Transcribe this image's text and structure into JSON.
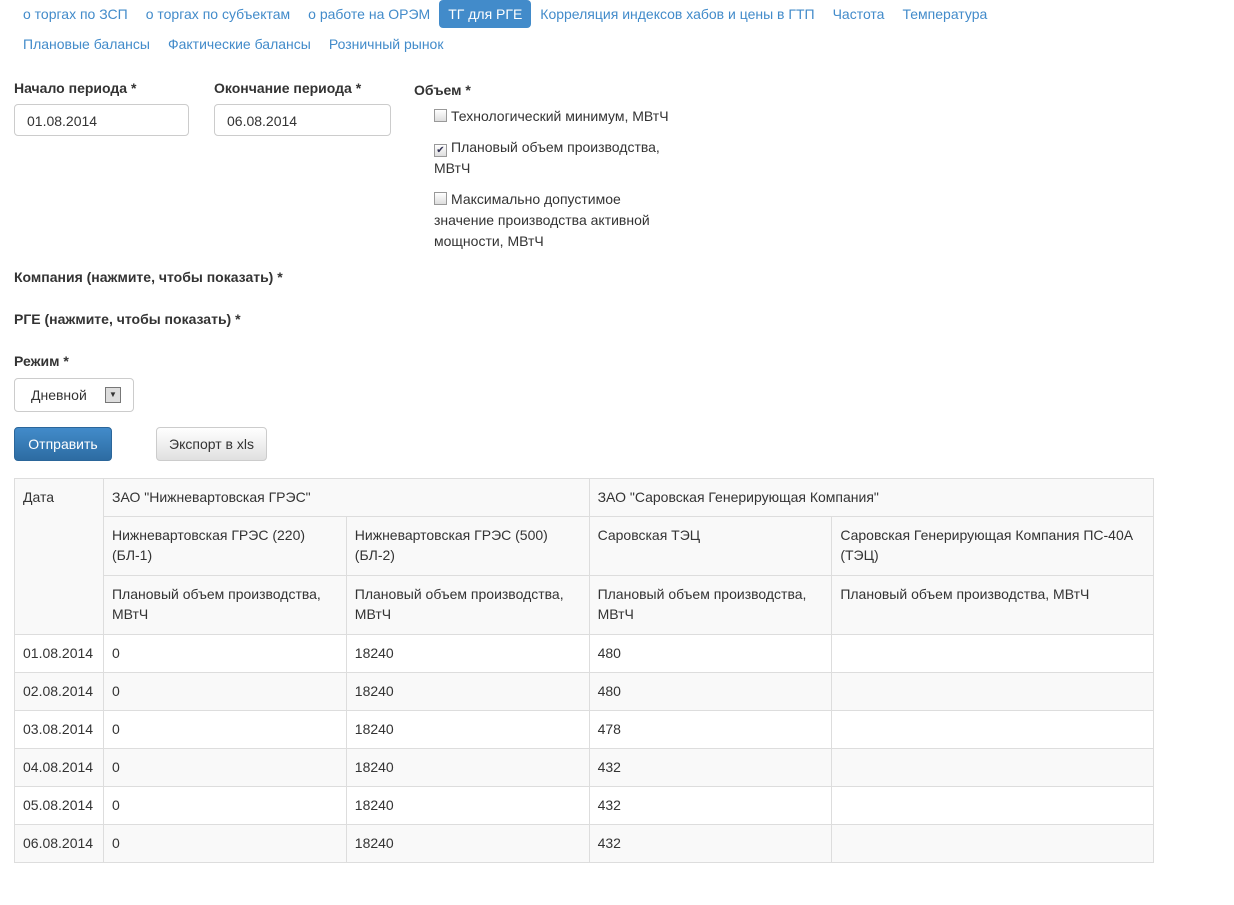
{
  "nav": {
    "row1": [
      "о торгах по ЗСП",
      "о торгах по субъектам",
      "о работе на ОРЭМ",
      "ТГ для РГЕ",
      "Корреляция индексов хабов и цены в ГТП",
      "Частота",
      "Температура"
    ],
    "row2": [
      "Плановые балансы",
      "Фактические балансы",
      "Розничный рынок"
    ],
    "active": "ТГ для РГЕ"
  },
  "form": {
    "start_label": "Начало периода *",
    "start_value": "01.08.2014",
    "end_label": "Окончание периода *",
    "end_value": "06.08.2014",
    "volume_label": "Объем *",
    "checkboxes": [
      {
        "label": "Технологический минимум, МВтЧ",
        "checked": false
      },
      {
        "label": "Плановый объем производства, МВтЧ",
        "checked": true
      },
      {
        "label": "Максимально допустимое значение производства активной мощности, МВтЧ",
        "checked": false
      }
    ],
    "company_label": "Компания (нажмите, чтобы показать) *",
    "rge_label": "РГЕ (нажмите, чтобы показать) *",
    "mode_label": "Режим *",
    "mode_value": "Дневной",
    "submit": "Отправить",
    "export": "Экспорт в xls"
  },
  "table": {
    "date_header": "Дата",
    "companies": [
      "ЗАО \"Нижневартовская ГРЭС\"",
      "ЗАО \"Саровская Генерирующая Компания\""
    ],
    "stations": [
      "Нижневартовская ГРЭС (220) (БЛ-1)",
      "Нижневартовская ГРЭС (500) (БЛ-2)",
      "Саровская ТЭЦ",
      "Саровская Генерирующая Компания ПС-40А (ТЭЦ)"
    ],
    "metrics": [
      "Плановый объем производства, МВтЧ",
      "Плановый объем производства, МВтЧ",
      "Плановый объем производства, МВтЧ",
      "Плановый объем производства, МВтЧ"
    ],
    "rows": [
      [
        "01.08.2014",
        "0",
        "18240",
        "480",
        ""
      ],
      [
        "02.08.2014",
        "0",
        "18240",
        "480",
        ""
      ],
      [
        "03.08.2014",
        "0",
        "18240",
        "478",
        ""
      ],
      [
        "04.08.2014",
        "0",
        "18240",
        "432",
        ""
      ],
      [
        "05.08.2014",
        "0",
        "18240",
        "432",
        ""
      ],
      [
        "06.08.2014",
        "0",
        "18240",
        "432",
        ""
      ]
    ]
  }
}
